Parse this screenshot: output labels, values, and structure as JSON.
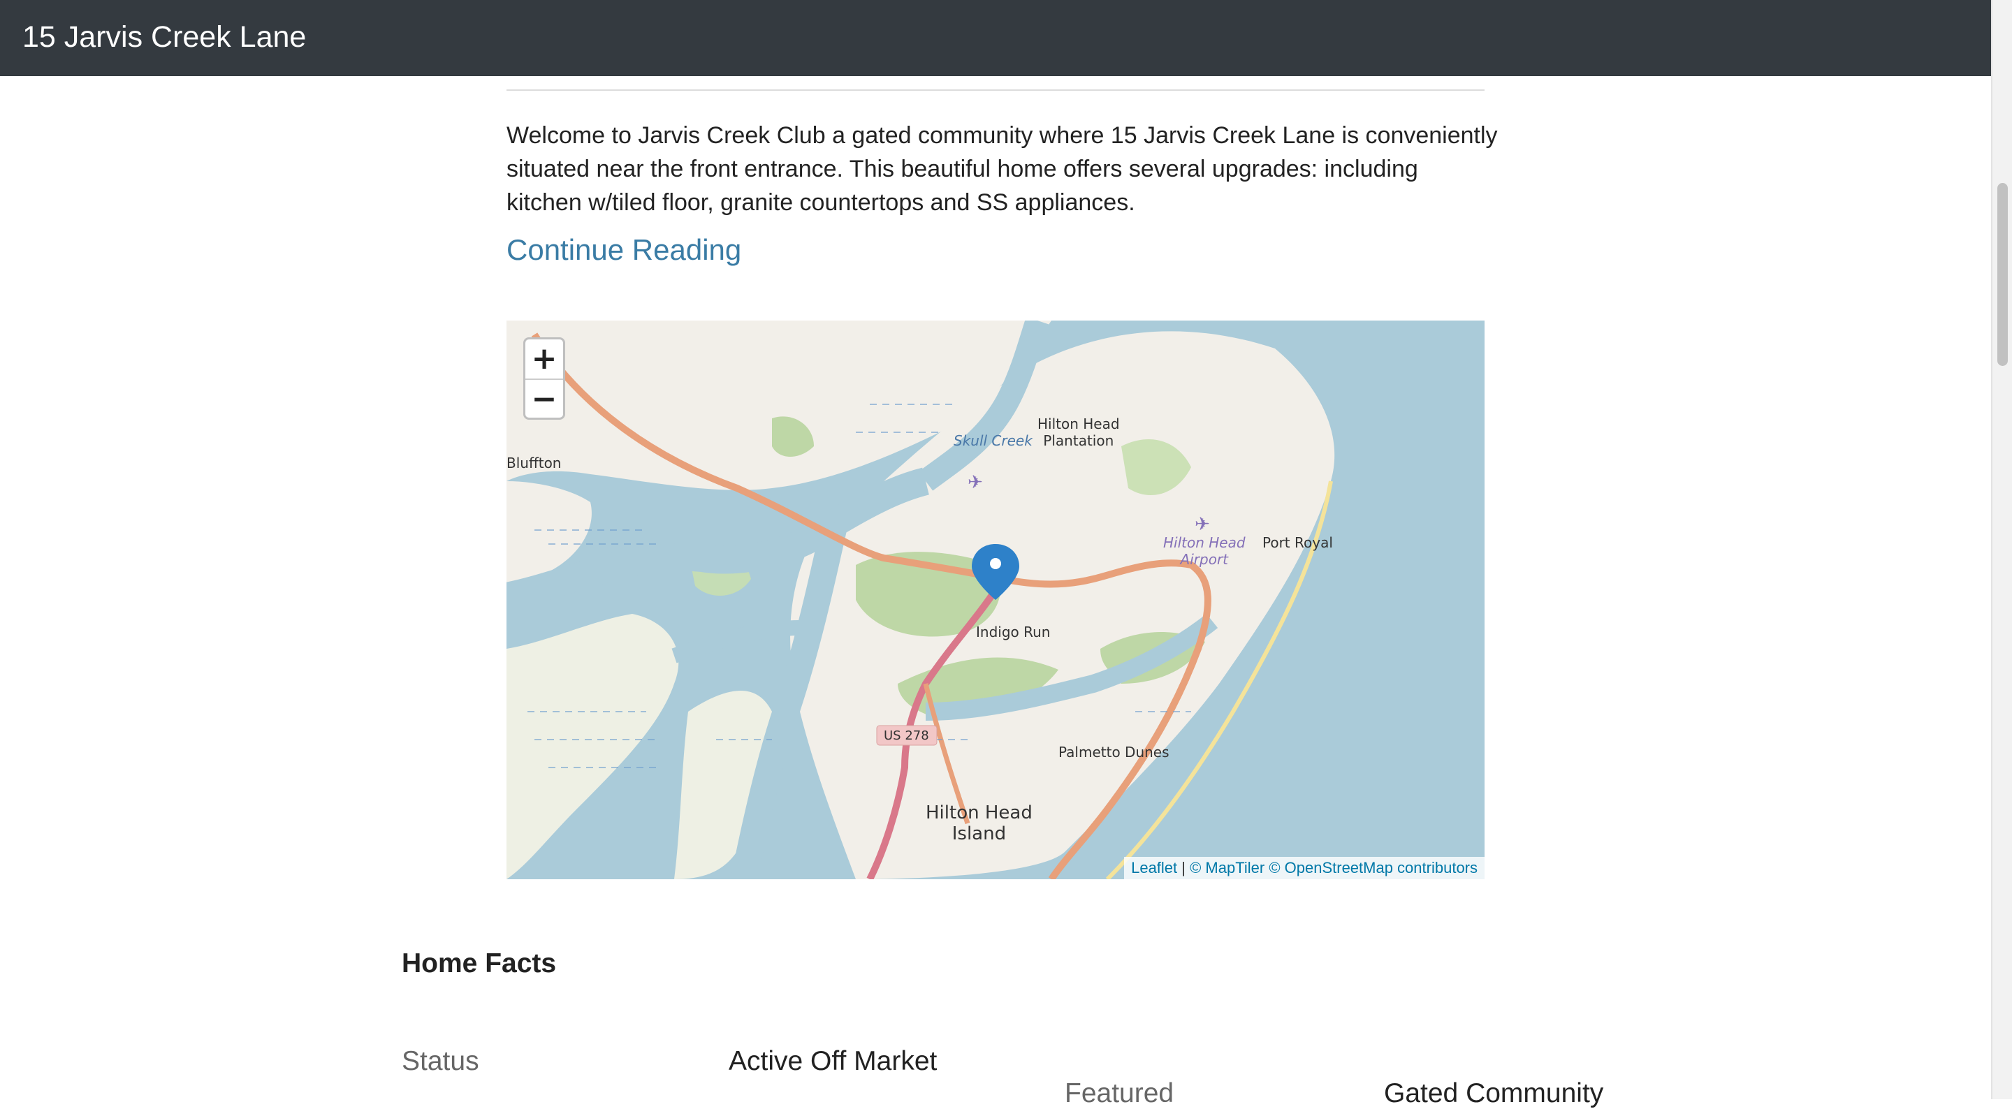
{
  "header": {
    "title": "15 Jarvis Creek Lane"
  },
  "listing": {
    "description": "Welcome to Jarvis Creek Club a gated community where 15 Jarvis Creek Lane is conveniently situated near the front entrance. This beautiful home offers several upgrades: including kitchen w/tiled floor, granite countertops and SS appliances.",
    "continue_label": "Continue Reading"
  },
  "map": {
    "zoom_in_label": "+",
    "zoom_out_label": "−",
    "attribution": {
      "leaflet": "Leaflet",
      "separator": " | ",
      "maptiler": "© MapTiler",
      "osm": "© OpenStreetMap contributors"
    },
    "labels": {
      "hilton_head_plantation_1": "Hilton Head",
      "hilton_head_plantation_2": "Plantation",
      "bluffton": "Bluffton",
      "skull_creek": "Skull Creek",
      "airport_1": "Hilton Head",
      "airport_2": "Airport",
      "port_royal": "Port Royal",
      "indigo_run": "Indigo Run",
      "us278": "US 278",
      "palmetto_dunes": "Palmetto Dunes",
      "hhi_1": "Hilton Head",
      "hhi_2": "Island"
    },
    "colors": {
      "water": "#aacbd9",
      "land": "#f2efe9",
      "marsh": "#b5d29a",
      "road": "#e8a07a",
      "marker": "#2e81c9"
    }
  },
  "home_facts": {
    "title": "Home Facts",
    "status_label": "Status",
    "status_value": "Active Off Market",
    "featured_label": "Featured",
    "featured_value": "Gated Community"
  }
}
